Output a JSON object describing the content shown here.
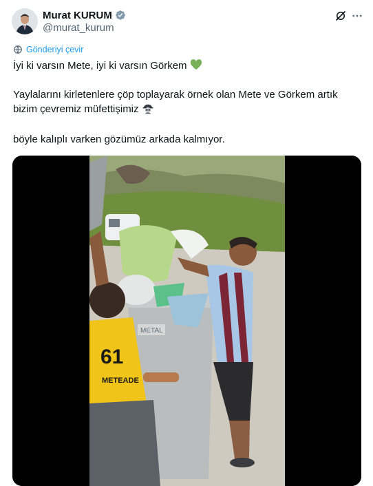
{
  "author": {
    "display_name": "Murat KURUM",
    "handle": "@murat_kurum",
    "verified_icon": "verified-badge-icon"
  },
  "actions": {
    "grok_icon": "grok-icon",
    "more_icon": "more-icon"
  },
  "translate": {
    "label": "Gönderiyi çevir",
    "icon": "translate-icon"
  },
  "post": {
    "line1": "İyi ki varsın Mete, iyi ki varsın Görkem",
    "line2": "Yaylalarını kirletenlere çöp toplayarak örnek olan Mete ve Görkem artık bizim çevremiz müfettişimiz",
    "line3": "böyle kalıplı varken gözümüz arkada kalmıyor.",
    "emoji1": "green-heart",
    "emoji2": "detective"
  },
  "media": {
    "type": "video",
    "shirt_number": "61",
    "shirt_name": "METEADE",
    "bin_text": "METAL",
    "accent": "#1d9bf0",
    "heart_color": "#78b159"
  }
}
